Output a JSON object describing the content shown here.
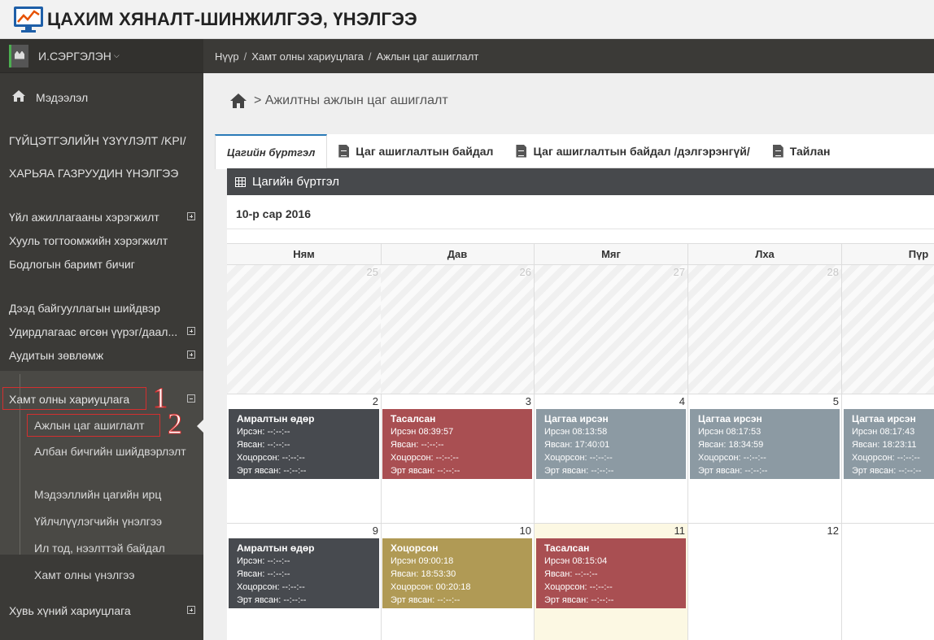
{
  "app": {
    "title": "ЦАХИМ ХЯНАЛТ-ШИНЖИЛГЭЭ, ҮНЭЛГЭЭ",
    "logo": "monitor-chart-icon"
  },
  "user": {
    "name": "И.СЭРГЭЛЭН"
  },
  "sidebar": {
    "items": [
      {
        "label": "Мэдээлэл"
      },
      {
        "label": "ГҮЙЦЭТГЭЛИЙН ҮЗҮҮЛЭЛТ /KPI/"
      },
      {
        "label": "ХАРЬЯА ГАЗРУУДИН ҮНЭЛГЭЭ"
      },
      {
        "label": "Үйл ажиллагааны хэрэгжилт"
      },
      {
        "label": "Хууль тогтоомжийн хэрэгжилт"
      },
      {
        "label": "Бодлогын баримт бичиг"
      },
      {
        "label": "Дээд байгууллагын шийдвэр"
      },
      {
        "label": "Удирдлагаас өгсөн үүрэг/даал..."
      },
      {
        "label": "Аудитын зөвлөмж"
      },
      {
        "label": "Хамт олны хариуцлага"
      },
      {
        "label": "Хувь хүний хариуцлага"
      }
    ],
    "submenu": [
      {
        "label": "Ажлын цаг ашиглалт"
      },
      {
        "label": "Албан бичгийн шийдвэрлэлт"
      },
      {
        "label": "Мэдээллийн цагийн ирц"
      },
      {
        "label": "Үйлчлүүлэгчийн үнэлгээ"
      },
      {
        "label": "Ил тод, нээлттэй байдал"
      },
      {
        "label": "Хамт олны үнэлгээ"
      }
    ],
    "annotations": [
      "1",
      "2"
    ]
  },
  "breadcrumb": [
    "Нүүр",
    "Хамт олны хариуцлага",
    "Ажлын цаг ашиглалт"
  ],
  "page_title": "> Ажилтны ажлын цаг ашиглалт",
  "tabs": [
    {
      "label": "Цагийн бүртгэл",
      "active": true
    },
    {
      "label": "Цаг ашиглалтын байдал"
    },
    {
      "label": "Цаг ашиглалтын байдал /дэлгэрэнгүй/"
    },
    {
      "label": "Тайлан"
    }
  ],
  "panel": {
    "title": "Цагийн бүртгэл",
    "month": "10-р сар 2016"
  },
  "calendar": {
    "weekdays": [
      "Ням",
      "Дав",
      "Мяг",
      "Лха",
      "Пүр"
    ],
    "weeks": [
      [
        {
          "day": "25"
        },
        {
          "day": "26"
        },
        {
          "day": "27"
        },
        {
          "day": "28"
        },
        {
          "day": ""
        }
      ],
      [
        {
          "day": "2",
          "event": {
            "title": "Амралтын өдөр",
            "color": "dark",
            "lines": [
              "Ирсэн: --:--:--",
              "Явсан: --:--:--",
              "Хоцорсон: --:--:--",
              "Эрт явсан: --:--:--"
            ]
          }
        },
        {
          "day": "3",
          "event": {
            "title": "Тасалсан",
            "color": "red",
            "lines": [
              "Ирсэн 08:39:57",
              "Явсан: --:--:--",
              "Хоцорсон: --:--:--",
              "Эрт явсан: --:--:--"
            ]
          }
        },
        {
          "day": "4",
          "event": {
            "title": "Цагтаа ирсэн",
            "color": "gray",
            "lines": [
              "Ирсэн 08:13:58",
              "Явсан: 17:40:01",
              "Хоцорсон: --:--:--",
              "Эрт явсан: --:--:--"
            ]
          }
        },
        {
          "day": "5",
          "event": {
            "title": "Цагтаа ирсэн",
            "color": "gray",
            "lines": [
              "Ирсэн 08:17:53",
              "Явсан: 18:34:59",
              "Хоцорсон: --:--:--",
              "Эрт явсан: --:--:--"
            ]
          }
        },
        {
          "day": "",
          "event": {
            "title": "Цагтаа ирсэн",
            "color": "gray",
            "lines": [
              "Ирсэн 08:17:43",
              "Явсан: 18:23:11",
              "Хоцорсон: --:--:--",
              "Эрт явсан: --:--:--"
            ]
          }
        }
      ],
      [
        {
          "day": "9",
          "event": {
            "title": "Амралтын өдөр",
            "color": "dark",
            "lines": [
              "Ирсэн: --:--:--",
              "Явсан: --:--:--",
              "Хоцорсон: --:--:--",
              "Эрт явсан: --:--:--"
            ]
          }
        },
        {
          "day": "10",
          "event": {
            "title": "Хоцорсон",
            "color": "gold",
            "lines": [
              "Ирсэн 09:00:18",
              "Явсан: 18:53:30",
              "Хоцорсон: 00:20:18",
              "Эрт явсан: --:--:--"
            ]
          }
        },
        {
          "day": "11",
          "today": true,
          "event": {
            "title": "Тасалсан",
            "color": "red",
            "lines": [
              "Ирсэн 08:15:04",
              "Явсан: --:--:--",
              "Хоцорсон: --:--:--",
              "Эрт явсан: --:--:--"
            ]
          }
        },
        {
          "day": "12"
        },
        {
          "day": ""
        }
      ]
    ]
  },
  "colors": {
    "dark": "#474a4f",
    "red": "#a94f52",
    "gray": "#8c9aa3",
    "gold": "#b09a55",
    "sidebar": "#3b3a37",
    "accent": "#d32f2f"
  }
}
